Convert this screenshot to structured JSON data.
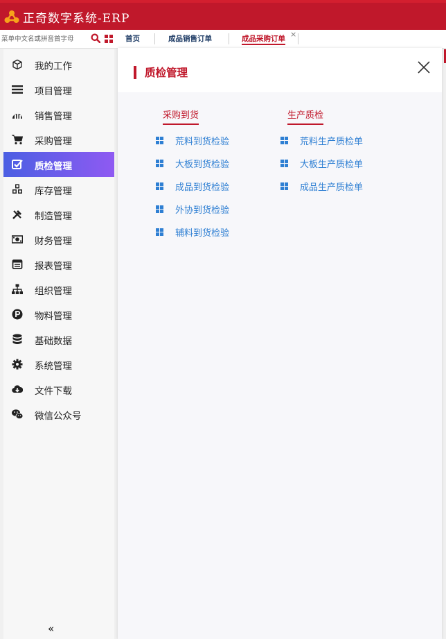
{
  "app": {
    "title": "正奇数字系统-ERP"
  },
  "search": {
    "placeholder": "菜单中文名或拼音首字母"
  },
  "tabs": [
    {
      "label": "首页"
    },
    {
      "label": "成品销售订单"
    },
    {
      "label": "成品采购订单",
      "active": true,
      "close": "×"
    }
  ],
  "sidebar": {
    "items": [
      {
        "label": "我的工作",
        "icon": "cube-icon"
      },
      {
        "label": "项目管理",
        "icon": "list-icon"
      },
      {
        "label": "销售管理",
        "icon": "chart-icon"
      },
      {
        "label": "采购管理",
        "icon": "cart-icon"
      },
      {
        "label": "质检管理",
        "icon": "checkbox-icon",
        "active": true
      },
      {
        "label": "库存管理",
        "icon": "cubes-icon"
      },
      {
        "label": "制造管理",
        "icon": "tools-icon"
      },
      {
        "label": "财务管理",
        "icon": "money-icon"
      },
      {
        "label": "报表管理",
        "icon": "calendar-icon"
      },
      {
        "label": "组织管理",
        "icon": "org-icon"
      },
      {
        "label": "物料管理",
        "icon": "p-circle-icon"
      },
      {
        "label": "基础数据",
        "icon": "database-icon"
      },
      {
        "label": "系统管理",
        "icon": "gear-icon"
      },
      {
        "label": "文件下载",
        "icon": "cloud-download-icon"
      },
      {
        "label": "微信公众号",
        "icon": "wechat-icon"
      }
    ],
    "collapse_label": "«"
  },
  "panel": {
    "title": "质检管理",
    "groups": [
      {
        "title": "采购到货",
        "links": [
          "荒料到货检验",
          "大板到货检验",
          "成品到货检验",
          "外协到货检验",
          "辅料到货检验"
        ]
      },
      {
        "title": "生产质检",
        "links": [
          "荒料生产质检单",
          "大板生产质检单",
          "成品生产质检单"
        ]
      }
    ]
  },
  "colors": {
    "brand": "#c0182b",
    "link": "#2e7fd3",
    "active_start": "#4b5fe3",
    "active_end": "#8f5af2"
  }
}
